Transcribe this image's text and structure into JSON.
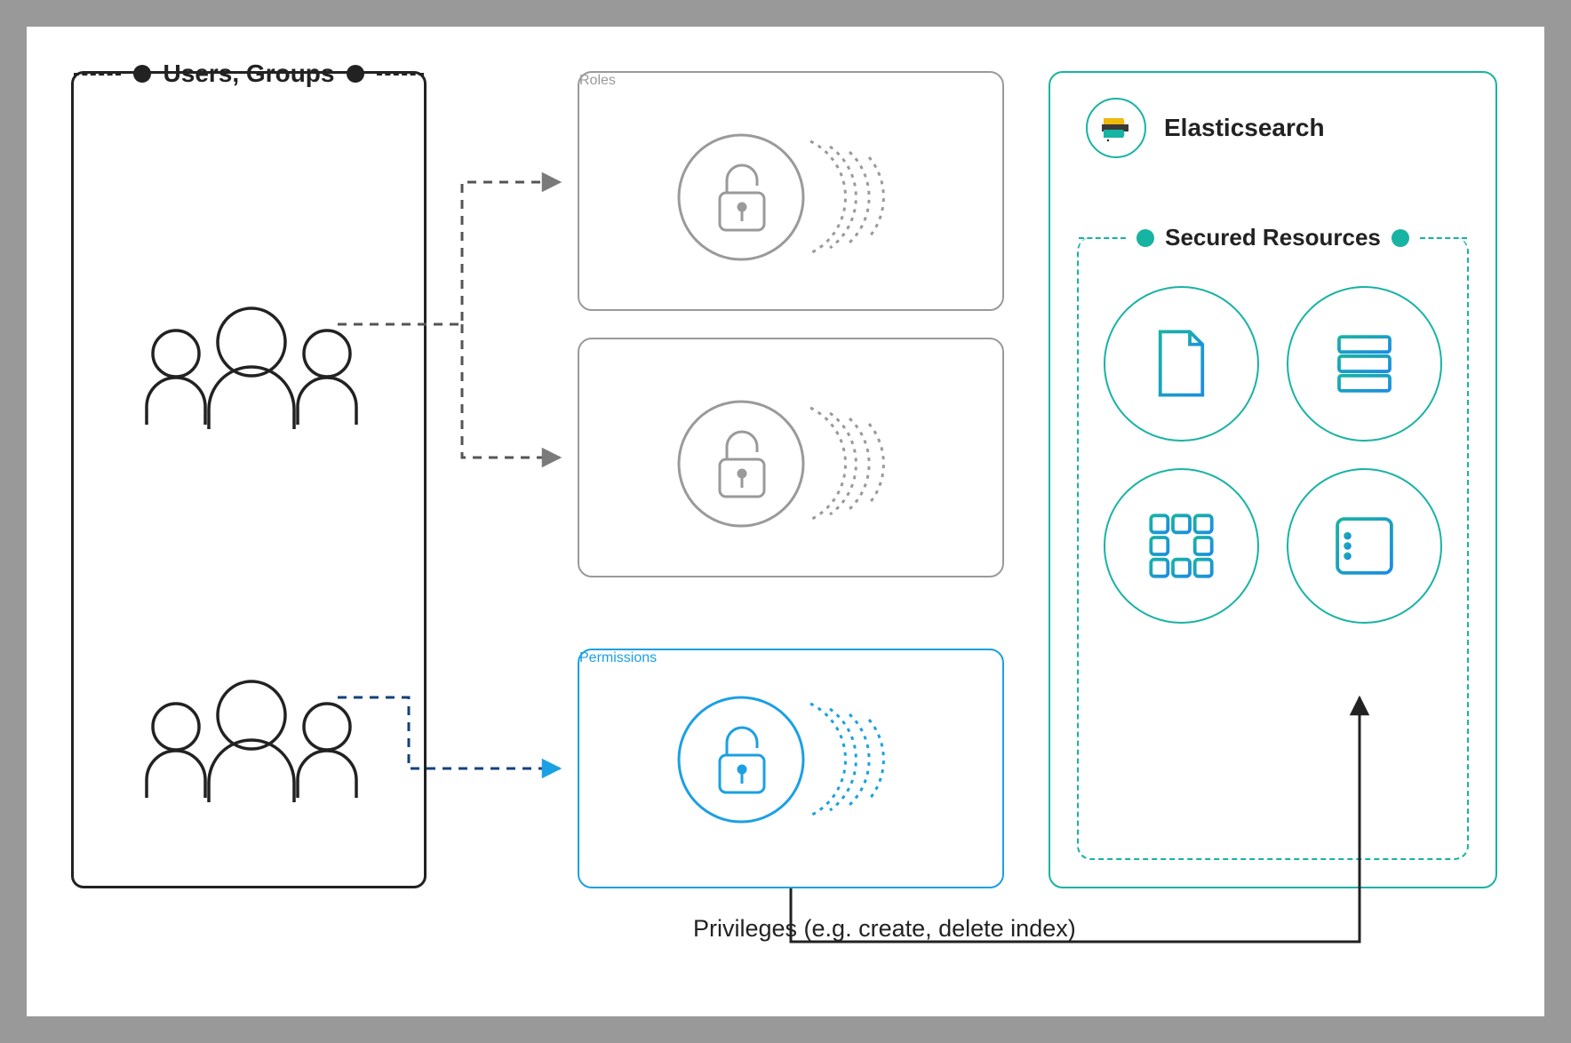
{
  "users_groups": {
    "label": "Users, Groups"
  },
  "roles": {
    "label": "Roles"
  },
  "permissions": {
    "label": "Permissions"
  },
  "elasticsearch": {
    "label": "Elasticsearch"
  },
  "secured_resources": {
    "label": "Secured Resources"
  },
  "privileges": {
    "label": "Privileges (e.g. create, delete index)"
  },
  "colors": {
    "black": "#222222",
    "gray": "#9a9a9a",
    "blue": "#1ba0e3",
    "teal": "#17b3a3",
    "brand_yellow": "#f0b90b",
    "brand_blue": "#0077cc"
  },
  "resources": [
    "document",
    "stack",
    "nodes",
    "list"
  ]
}
